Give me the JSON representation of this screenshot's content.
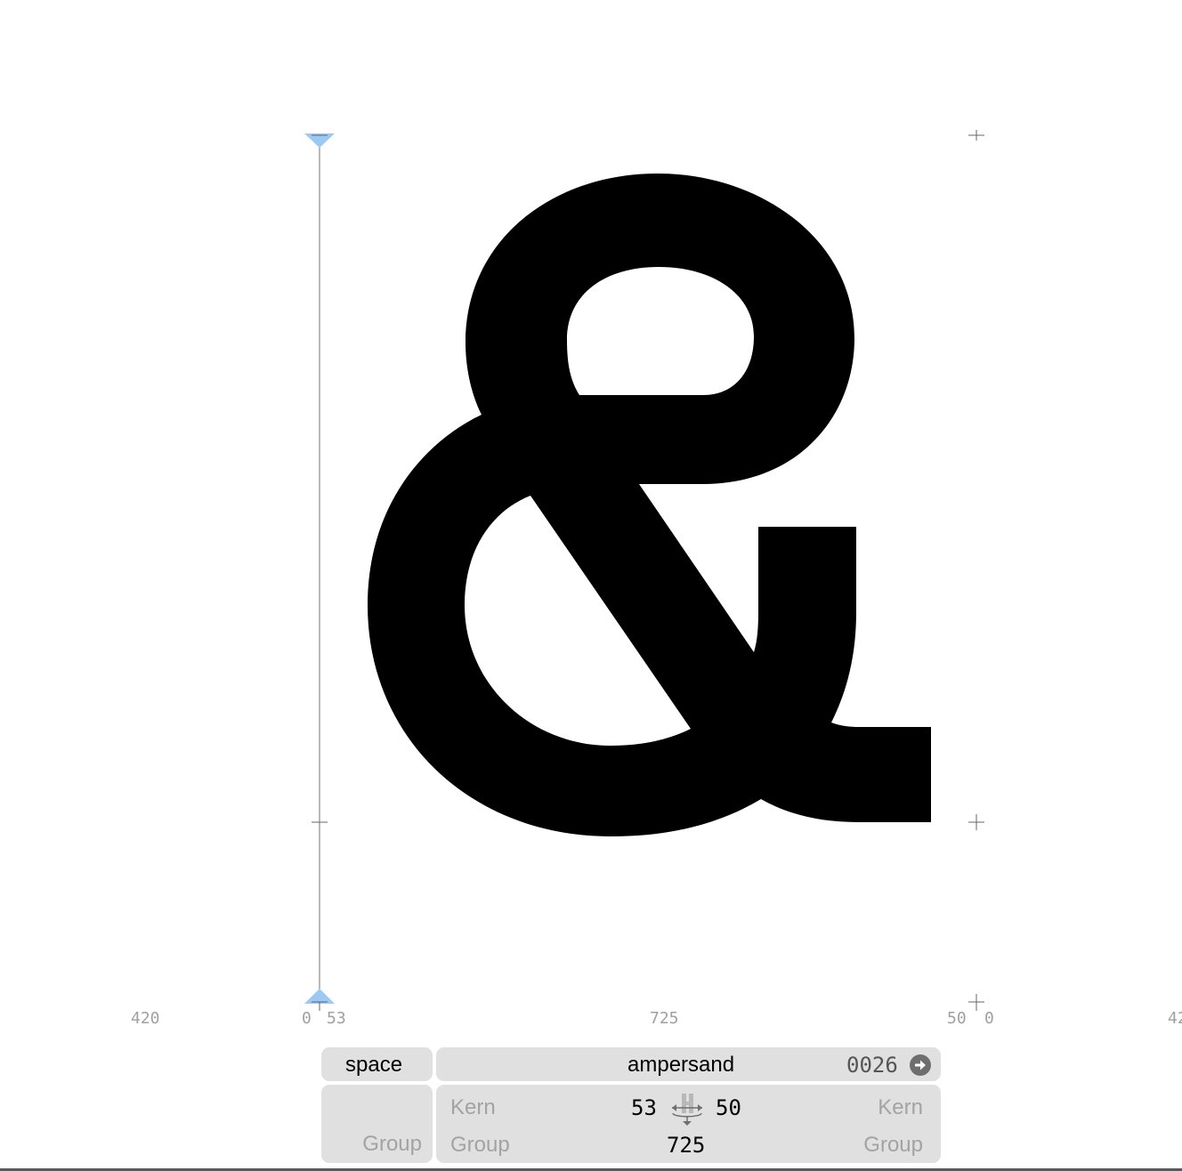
{
  "glyph": {
    "char": "&",
    "name": "ampersand",
    "unicode": "0026",
    "width": "725",
    "lsb": "53",
    "rsb": "50",
    "kern_label": "Kern",
    "group_label": "Group"
  },
  "metrics_row": {
    "left_neighbor_width": "420",
    "left_neighbor_rsb": "0",
    "right_neighbor_lsb": "0",
    "right_neighbor_width_partial": "42"
  },
  "prev_glyph": {
    "name": "space",
    "group_label": "Group"
  },
  "colors": {
    "glyph_fill": "#000000",
    "panel_bg": "#e0e0e0",
    "metric_text": "#a0a0a0",
    "marker_blue": "#9cc8f5",
    "line_grey": "#8a8a8a"
  },
  "icons": {
    "next_glyph": "arrow-right-circle-icon",
    "metrics_link": "metrics-link-icon",
    "top_marker": "blue-triangle-down-icon",
    "bottom_marker": "blue-triangle-up-icon"
  }
}
